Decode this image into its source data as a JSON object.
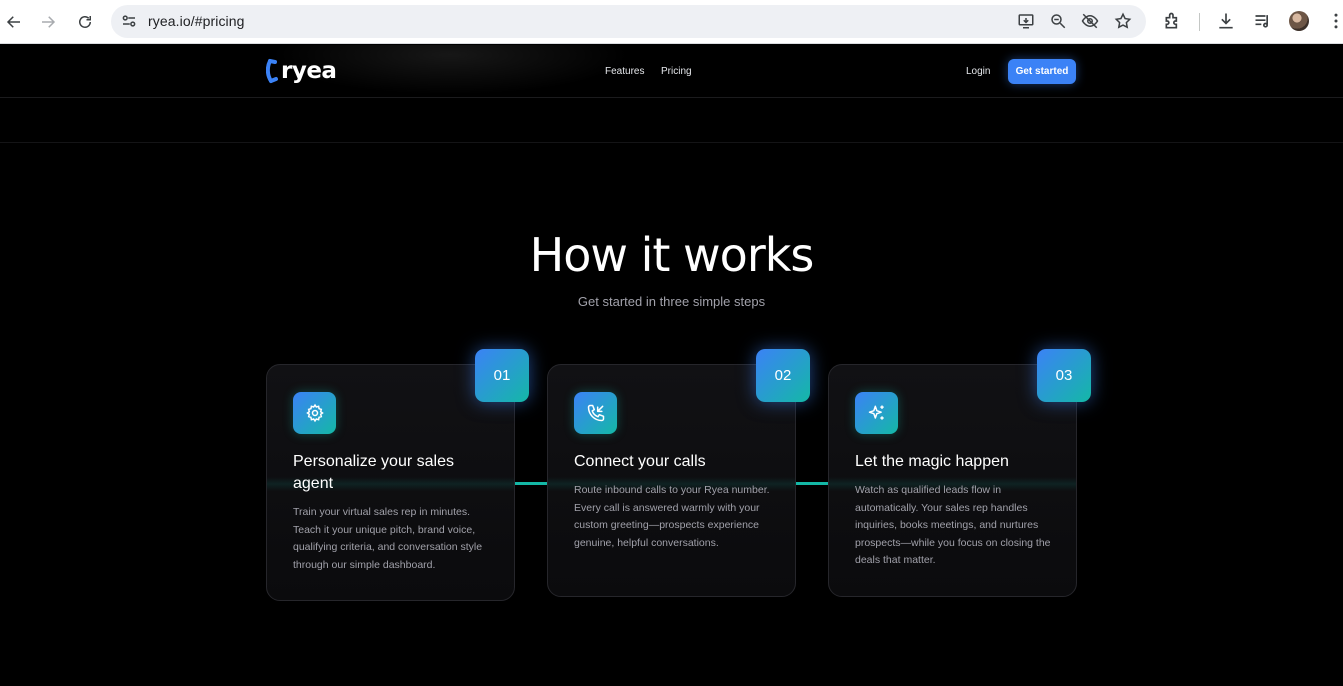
{
  "browser": {
    "url": "ryea.io/#pricing",
    "icons": [
      "back-icon",
      "forward-icon",
      "reload-icon",
      "site-info-icon",
      "install-app-icon",
      "zoom-icon",
      "eye-off-icon",
      "bookmark-star-icon",
      "extensions-icon",
      "download-icon",
      "media-queue-icon",
      "profile-avatar",
      "more-icon"
    ]
  },
  "site": {
    "brand": "ryea",
    "nav": {
      "features": "Features",
      "pricing": "Pricing",
      "login": "Login",
      "cta": "Get started"
    },
    "colors": {
      "accent": "#3b82f6",
      "teal": "#14b8a6",
      "background": "#000000"
    }
  },
  "how_it_works": {
    "title": "How it works",
    "subtitle": "Get started in three simple steps",
    "steps": [
      {
        "number": "01",
        "icon": "gear-icon",
        "title": "Personalize your sales agent",
        "description": "Train your virtual sales rep in minutes. Teach it your unique pitch, brand voice, qualifying criteria, and conversation style through our simple dashboard."
      },
      {
        "number": "02",
        "icon": "phone-incoming-icon",
        "title": "Connect your calls",
        "description": "Route inbound calls to your Ryea number. Every call is answered warmly with your custom greeting—prospects experience genuine, helpful conversations."
      },
      {
        "number": "03",
        "icon": "sparkles-icon",
        "title": "Let the magic happen",
        "description": "Watch as qualified leads flow in automatically. Your sales rep handles inquiries, books meetings, and nurtures prospects—while you focus on closing the deals that matter."
      }
    ]
  }
}
